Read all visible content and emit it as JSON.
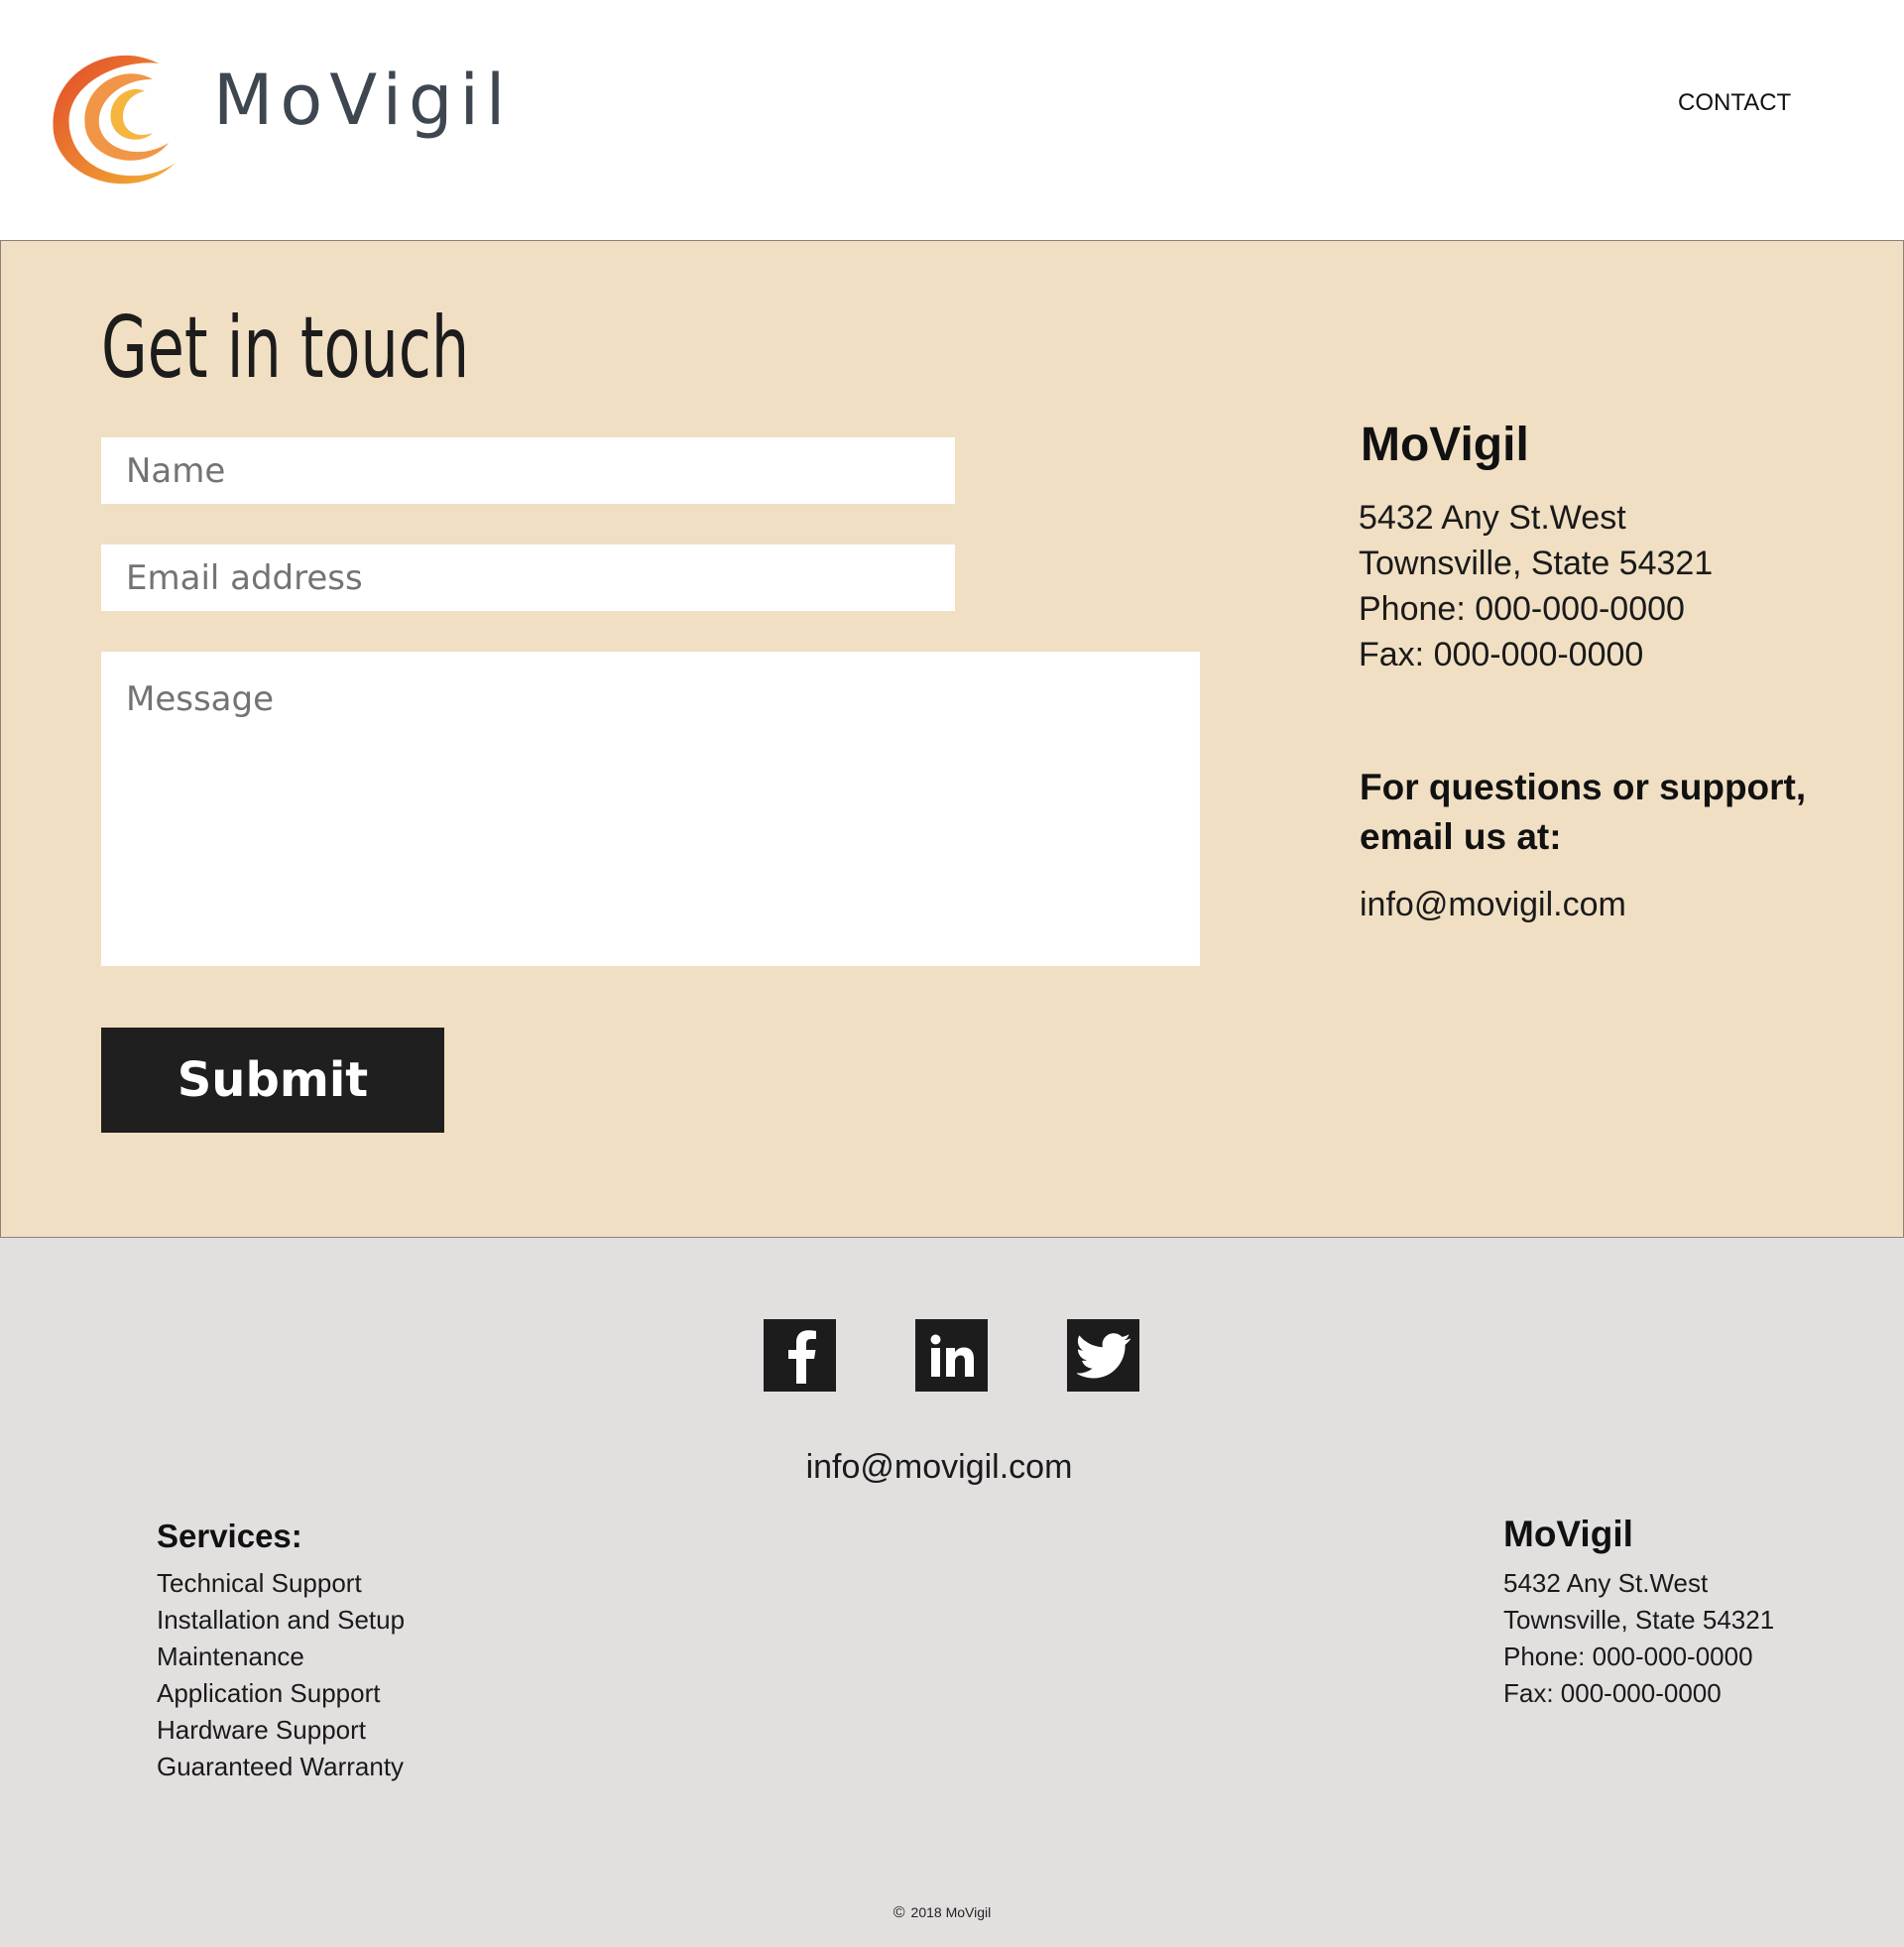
{
  "header": {
    "brand_name": "MoVigil",
    "nav": {
      "contact": "CONTACT"
    }
  },
  "contact_section": {
    "title": "Get in touch",
    "form": {
      "name_placeholder": "Name",
      "email_placeholder": "Email address",
      "message_placeholder": "Message",
      "submit_label": "Submit"
    },
    "info": {
      "company": "MoVigil",
      "address_line1": "5432 Any St.West",
      "address_line2": "Townsville, State 54321",
      "phone": "Phone: 000-000-0000",
      "fax": "Fax: 000-000-0000",
      "support_heading": "For questions or support, email us at:",
      "email": "info@movigil.com"
    }
  },
  "footer": {
    "social": [
      "facebook-icon",
      "linkedin-icon",
      "twitter-icon"
    ],
    "email": "info@movigil.com",
    "services_title": "Services:",
    "services": [
      "Technical Support",
      "Installation and Setup",
      "Maintenance",
      "Application Support",
      "Hardware Support",
      "Guaranteed Warranty"
    ],
    "company": "MoVigil",
    "address_line1": "5432 Any St.West",
    "address_line2": "Townsville, State 54321",
    "phone": "Phone: 000-000-0000",
    "fax": "Fax: 000-000-0000",
    "copyright": "2018 MoVigil"
  },
  "colors": {
    "contact_bg": "#f0dfc3",
    "footer_bg": "#e2dfdf",
    "button_bg": "#1f1f1f",
    "logo_orange": "#e86a2c",
    "logo_yellow": "#f0a830",
    "brand_gray": "#3e4650"
  }
}
